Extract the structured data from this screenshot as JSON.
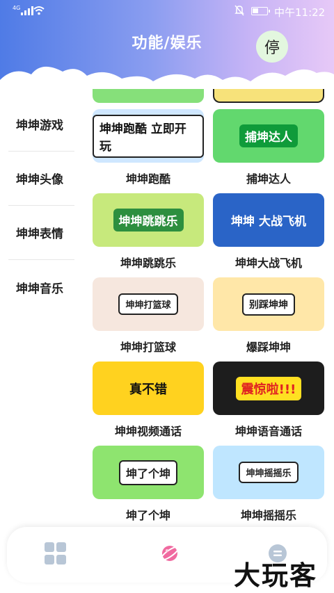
{
  "status_bar": {
    "network": "4G",
    "time": "中午11:22"
  },
  "header": {
    "title": "功能/娱乐",
    "stop_label": "停"
  },
  "sidebar": {
    "items": [
      {
        "label": "坤坤游戏"
      },
      {
        "label": "坤坤头像"
      },
      {
        "label": "坤坤表情"
      },
      {
        "label": "坤坤音乐"
      }
    ]
  },
  "cards": [
    {
      "caption": "坤坤跑酷",
      "thumb_text": "坤坤跑酷 立即开玩"
    },
    {
      "caption": "捕坤达人",
      "thumb_text": "捕坤达人"
    },
    {
      "caption": "坤坤跳跳乐",
      "thumb_text": "坤坤跳跳乐"
    },
    {
      "caption": "坤坤大战飞机",
      "thumb_text": "坤坤 大战飞机"
    },
    {
      "caption": "坤坤打篮球",
      "thumb_text": "坤坤打篮球"
    },
    {
      "caption": "爆踩坤坤",
      "thumb_text": "别踩坤坤"
    },
    {
      "caption": "坤坤视频通话",
      "thumb_text": "真不错"
    },
    {
      "caption": "坤坤语音通话",
      "thumb_text": "震惊啦!!!"
    },
    {
      "caption": "坤了个坤",
      "thumb_text": "坤了个坤"
    },
    {
      "caption": "坤坤摇摇乐",
      "thumb_text": "坤坤摇摇乐"
    }
  ],
  "bottom_nav": {
    "icons": [
      "grid-icon",
      "planet-icon",
      "list-icon"
    ]
  },
  "watermark": "大玩客",
  "colors": {
    "header_start": "#4f7be6",
    "header_end": "#e7c9f7",
    "accent_pink": "#f06aa0"
  }
}
